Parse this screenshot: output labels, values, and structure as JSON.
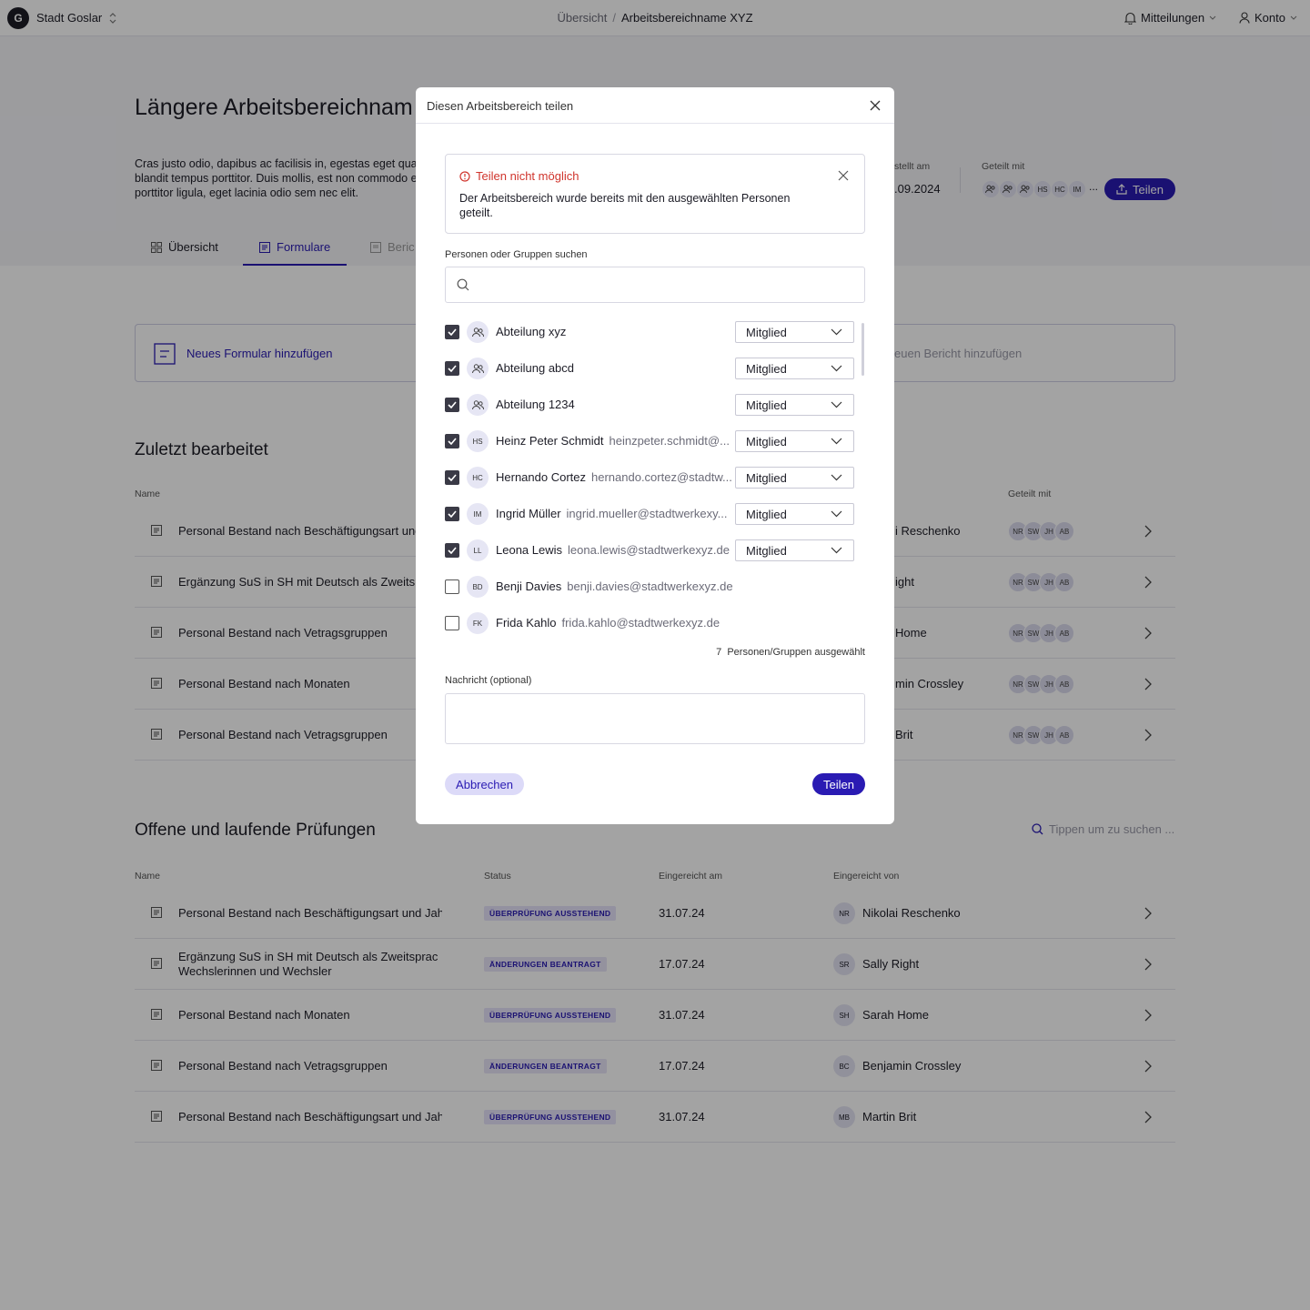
{
  "topbar": {
    "logo_letter": "G",
    "org": "Stadt Goslar",
    "breadcrumb": [
      "Übersicht",
      "Arbeitsbereichname XYZ"
    ],
    "notifications": "Mitteilungen",
    "account": "Konto"
  },
  "workspace": {
    "title": "Längere Arbeitsbereichnam",
    "description": "Cras justo odio, dapibus ac facilisis in, egestas eget quan blandit tempus porttitor. Duis mollis, est non commodo erat porttitor ligula, eget lacinia odio sem nec elit.",
    "created_label": "stellt am",
    "created_value": ".09.2024",
    "shared_label": "Geteilt mit",
    "shared_avatars": [
      "HS",
      "HC",
      "IM"
    ],
    "shared_more": "...",
    "share_button": "Teilen"
  },
  "tabs": [
    "Übersicht",
    "Formulare",
    "Beric"
  ],
  "actions": {
    "new_form": "Neues Formular hinzufügen",
    "new_report": "euen Bericht hinzufügen"
  },
  "recent": {
    "title": "Zuletzt bearbeitet",
    "col_name": "Name",
    "col_shared": "Geteilt mit",
    "stack": [
      "NR",
      "SW",
      "JH",
      "AB"
    ],
    "rows": [
      {
        "name": "Personal Bestand nach Beschäftigungsart und J",
        "by": "i Reschenko"
      },
      {
        "name": "Ergänzung SuS in SH mit Deutsch als Zweitspra",
        "by": "ight"
      },
      {
        "name": "Personal Bestand nach Vetragsgruppen",
        "by": "Home"
      },
      {
        "name": "Personal Bestand nach Monaten",
        "by": "min Crossley"
      },
      {
        "name": "Personal Bestand nach Vetragsgruppen",
        "by": "Brit"
      }
    ]
  },
  "reviews": {
    "title": "Offene und laufende Prüfungen",
    "search_placeholder": "Tippen um zu suchen ...",
    "cols": [
      "Name",
      "Status",
      "Eingereicht am",
      "Eingereicht von"
    ],
    "rows": [
      {
        "name": "Personal Bestand nach Beschäftigungsart und Jahr",
        "name2": "",
        "status": "ÜBERPRÜFUNG AUSSTEHEND",
        "date": "31.07.24",
        "initials": "NR",
        "by": "Nikolai Reschenko"
      },
      {
        "name": "Ergänzung SuS in SH mit Deutsch als Zweitsprache:",
        "name2": "Wechslerinnen und Wechsler",
        "status": "ÄNDERUNGEN BEANTRAGT",
        "date": "17.07.24",
        "initials": "SR",
        "by": "Sally Right"
      },
      {
        "name": "Personal Bestand nach Monaten",
        "name2": "",
        "status": "ÜBERPRÜFUNG AUSSTEHEND",
        "date": "31.07.24",
        "initials": "SH",
        "by": "Sarah Home"
      },
      {
        "name": "Personal Bestand nach Vetragsgruppen",
        "name2": "",
        "status": "ÄNDERUNGEN BEANTRAGT",
        "date": "17.07.24",
        "initials": "BC",
        "by": "Benjamin Crossley"
      },
      {
        "name": "Personal Bestand nach Beschäftigungsart und Jahr",
        "name2": "",
        "status": "ÜBERPRÜFUNG AUSSTEHEND",
        "date": "31.07.24",
        "initials": "MB",
        "by": "Martin Brit"
      }
    ]
  },
  "modal": {
    "title": "Diesen Arbeitsbereich teilen",
    "alert_title": "Teilen nicht möglich",
    "alert_body": "Der Arbeitsbereich wurde bereits mit den ausgewählten Personen geteilt.",
    "search_label": "Personen oder Gruppen suchen",
    "search_value": "",
    "people": [
      {
        "checked": true,
        "group": true,
        "initials": "",
        "name": "Abteilung xyz",
        "email": "",
        "role": "Mitglied"
      },
      {
        "checked": true,
        "group": true,
        "initials": "",
        "name": "Abteilung abcd",
        "email": "",
        "role": "Mitglied"
      },
      {
        "checked": true,
        "group": true,
        "initials": "",
        "name": "Abteilung 1234",
        "email": "",
        "role": "Mitglied"
      },
      {
        "checked": true,
        "group": false,
        "initials": "HS",
        "name": "Heinz Peter Schmidt",
        "email": "heinzpeter.schmidt@...",
        "role": "Mitglied"
      },
      {
        "checked": true,
        "group": false,
        "initials": "HC",
        "name": "Hernando Cortez",
        "email": "hernando.cortez@stadtw...",
        "role": "Mitglied"
      },
      {
        "checked": true,
        "group": false,
        "initials": "IM",
        "name": "Ingrid Müller",
        "email": "ingrid.mueller@stadtwerkexy...",
        "role": "Mitglied"
      },
      {
        "checked": true,
        "group": false,
        "initials": "LL",
        "name": "Leona Lewis",
        "email": "leona.lewis@stadtwerkexyz.de",
        "role": "Mitglied"
      },
      {
        "checked": false,
        "group": false,
        "initials": "BD",
        "name": "Benji Davies",
        "email": "benji.davies@stadtwerkexyz.de",
        "role": ""
      },
      {
        "checked": false,
        "group": false,
        "initials": "FK",
        "name": "Frida Kahlo",
        "email": "frida.kahlo@stadtwerkexyz.de",
        "role": ""
      }
    ],
    "selected_count": "7",
    "selected_label": "Personen/Gruppen ausgewählt",
    "message_label": "Nachricht (optional)",
    "message_value": "",
    "cancel": "Abbrechen",
    "submit": "Teilen"
  },
  "colors": {
    "accent": "#2a1bb3",
    "error": "#d0342c",
    "overlay": "rgba(0,0,0,0.36)"
  }
}
